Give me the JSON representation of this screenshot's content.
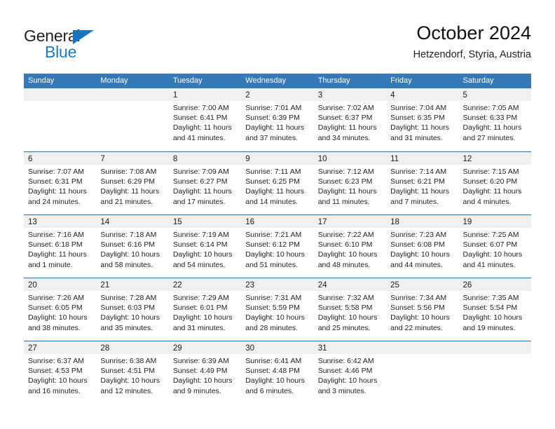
{
  "brand": {
    "word_one": "General",
    "word_two": "Blue",
    "flag_icon": "triangle-flag-icon",
    "accent_color": "#1b7ac4"
  },
  "header": {
    "title": "October 2024",
    "subtitle": "Hetzendorf, Styria, Austria"
  },
  "calendar": {
    "header_bg": "#3679b8",
    "row_divider_color": "#2e6da4",
    "day_band_bg": "#f0f0f0",
    "weekdays": [
      "Sunday",
      "Monday",
      "Tuesday",
      "Wednesday",
      "Thursday",
      "Friday",
      "Saturday"
    ],
    "weeks": [
      [
        {
          "day": "",
          "lines": []
        },
        {
          "day": "",
          "lines": []
        },
        {
          "day": "1",
          "lines": [
            "Sunrise: 7:00 AM",
            "Sunset: 6:41 PM",
            "Daylight: 11 hours",
            "and 41 minutes."
          ]
        },
        {
          "day": "2",
          "lines": [
            "Sunrise: 7:01 AM",
            "Sunset: 6:39 PM",
            "Daylight: 11 hours",
            "and 37 minutes."
          ]
        },
        {
          "day": "3",
          "lines": [
            "Sunrise: 7:02 AM",
            "Sunset: 6:37 PM",
            "Daylight: 11 hours",
            "and 34 minutes."
          ]
        },
        {
          "day": "4",
          "lines": [
            "Sunrise: 7:04 AM",
            "Sunset: 6:35 PM",
            "Daylight: 11 hours",
            "and 31 minutes."
          ]
        },
        {
          "day": "5",
          "lines": [
            "Sunrise: 7:05 AM",
            "Sunset: 6:33 PM",
            "Daylight: 11 hours",
            "and 27 minutes."
          ]
        }
      ],
      [
        {
          "day": "6",
          "lines": [
            "Sunrise: 7:07 AM",
            "Sunset: 6:31 PM",
            "Daylight: 11 hours",
            "and 24 minutes."
          ]
        },
        {
          "day": "7",
          "lines": [
            "Sunrise: 7:08 AM",
            "Sunset: 6:29 PM",
            "Daylight: 11 hours",
            "and 21 minutes."
          ]
        },
        {
          "day": "8",
          "lines": [
            "Sunrise: 7:09 AM",
            "Sunset: 6:27 PM",
            "Daylight: 11 hours",
            "and 17 minutes."
          ]
        },
        {
          "day": "9",
          "lines": [
            "Sunrise: 7:11 AM",
            "Sunset: 6:25 PM",
            "Daylight: 11 hours",
            "and 14 minutes."
          ]
        },
        {
          "day": "10",
          "lines": [
            "Sunrise: 7:12 AM",
            "Sunset: 6:23 PM",
            "Daylight: 11 hours",
            "and 11 minutes."
          ]
        },
        {
          "day": "11",
          "lines": [
            "Sunrise: 7:14 AM",
            "Sunset: 6:21 PM",
            "Daylight: 11 hours",
            "and 7 minutes."
          ]
        },
        {
          "day": "12",
          "lines": [
            "Sunrise: 7:15 AM",
            "Sunset: 6:20 PM",
            "Daylight: 11 hours",
            "and 4 minutes."
          ]
        }
      ],
      [
        {
          "day": "13",
          "lines": [
            "Sunrise: 7:16 AM",
            "Sunset: 6:18 PM",
            "Daylight: 11 hours",
            "and 1 minute."
          ]
        },
        {
          "day": "14",
          "lines": [
            "Sunrise: 7:18 AM",
            "Sunset: 6:16 PM",
            "Daylight: 10 hours",
            "and 58 minutes."
          ]
        },
        {
          "day": "15",
          "lines": [
            "Sunrise: 7:19 AM",
            "Sunset: 6:14 PM",
            "Daylight: 10 hours",
            "and 54 minutes."
          ]
        },
        {
          "day": "16",
          "lines": [
            "Sunrise: 7:21 AM",
            "Sunset: 6:12 PM",
            "Daylight: 10 hours",
            "and 51 minutes."
          ]
        },
        {
          "day": "17",
          "lines": [
            "Sunrise: 7:22 AM",
            "Sunset: 6:10 PM",
            "Daylight: 10 hours",
            "and 48 minutes."
          ]
        },
        {
          "day": "18",
          "lines": [
            "Sunrise: 7:23 AM",
            "Sunset: 6:08 PM",
            "Daylight: 10 hours",
            "and 44 minutes."
          ]
        },
        {
          "day": "19",
          "lines": [
            "Sunrise: 7:25 AM",
            "Sunset: 6:07 PM",
            "Daylight: 10 hours",
            "and 41 minutes."
          ]
        }
      ],
      [
        {
          "day": "20",
          "lines": [
            "Sunrise: 7:26 AM",
            "Sunset: 6:05 PM",
            "Daylight: 10 hours",
            "and 38 minutes."
          ]
        },
        {
          "day": "21",
          "lines": [
            "Sunrise: 7:28 AM",
            "Sunset: 6:03 PM",
            "Daylight: 10 hours",
            "and 35 minutes."
          ]
        },
        {
          "day": "22",
          "lines": [
            "Sunrise: 7:29 AM",
            "Sunset: 6:01 PM",
            "Daylight: 10 hours",
            "and 31 minutes."
          ]
        },
        {
          "day": "23",
          "lines": [
            "Sunrise: 7:31 AM",
            "Sunset: 5:59 PM",
            "Daylight: 10 hours",
            "and 28 minutes."
          ]
        },
        {
          "day": "24",
          "lines": [
            "Sunrise: 7:32 AM",
            "Sunset: 5:58 PM",
            "Daylight: 10 hours",
            "and 25 minutes."
          ]
        },
        {
          "day": "25",
          "lines": [
            "Sunrise: 7:34 AM",
            "Sunset: 5:56 PM",
            "Daylight: 10 hours",
            "and 22 minutes."
          ]
        },
        {
          "day": "26",
          "lines": [
            "Sunrise: 7:35 AM",
            "Sunset: 5:54 PM",
            "Daylight: 10 hours",
            "and 19 minutes."
          ]
        }
      ],
      [
        {
          "day": "27",
          "lines": [
            "Sunrise: 6:37 AM",
            "Sunset: 4:53 PM",
            "Daylight: 10 hours",
            "and 16 minutes."
          ]
        },
        {
          "day": "28",
          "lines": [
            "Sunrise: 6:38 AM",
            "Sunset: 4:51 PM",
            "Daylight: 10 hours",
            "and 12 minutes."
          ]
        },
        {
          "day": "29",
          "lines": [
            "Sunrise: 6:39 AM",
            "Sunset: 4:49 PM",
            "Daylight: 10 hours",
            "and 9 minutes."
          ]
        },
        {
          "day": "30",
          "lines": [
            "Sunrise: 6:41 AM",
            "Sunset: 4:48 PM",
            "Daylight: 10 hours",
            "and 6 minutes."
          ]
        },
        {
          "day": "31",
          "lines": [
            "Sunrise: 6:42 AM",
            "Sunset: 4:46 PM",
            "Daylight: 10 hours",
            "and 3 minutes."
          ]
        },
        {
          "day": "",
          "lines": []
        },
        {
          "day": "",
          "lines": []
        }
      ]
    ]
  }
}
